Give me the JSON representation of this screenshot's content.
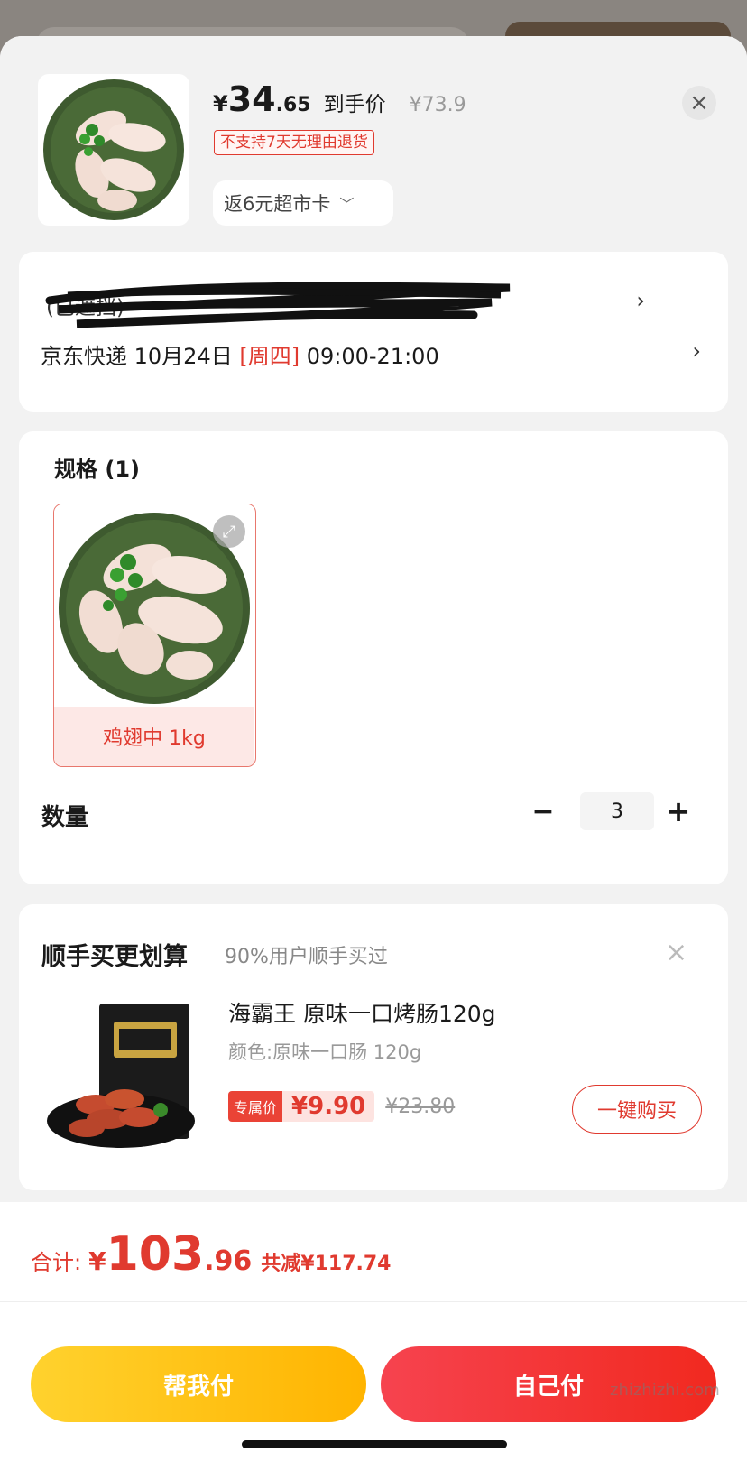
{
  "header": {
    "price_currency": "¥",
    "price_int": "34",
    "price_dec": ".65",
    "price_label": "到手价",
    "orig_price": "¥73.9",
    "no_return_badge": "不支持7天无理由退货",
    "cashback": "返6元超市卡",
    "close_icon": "close-icon"
  },
  "address": {
    "address_text": "(已遮挡)",
    "delivery_carrier": "京东快递",
    "delivery_date": "10月24日",
    "delivery_weekday": "[周四]",
    "delivery_time": "09:00-21:00"
  },
  "spec": {
    "title": "规格 (1)",
    "item_label": "鸡翅中 1kg",
    "qty_label": "数量",
    "qty_value": "3",
    "minus": "−",
    "plus": "+"
  },
  "addon": {
    "title": "顺手买更划算",
    "subtitle": "90%用户顺手买过",
    "product_name": "海霸王 原味一口烤肠120g",
    "product_color": "颜色:原味一口肠 120g",
    "exclusive_tag": "专属价",
    "exclusive_price": "¥9.90",
    "orig_price": "¥23.80",
    "buy_button": "一键购买"
  },
  "footer": {
    "total_label": "合计:",
    "total_currency": "¥",
    "total_int": "103",
    "total_dec": ".96",
    "total_saving": "共减¥117.74",
    "help_pay": "帮我付",
    "self_pay": "自己付"
  },
  "watermark": "zhizhizhi.com",
  "colors": {
    "accent_red": "#e03a2f",
    "help_pay_yellow": "#ffc21a",
    "self_pay_red": "#f3353a"
  }
}
